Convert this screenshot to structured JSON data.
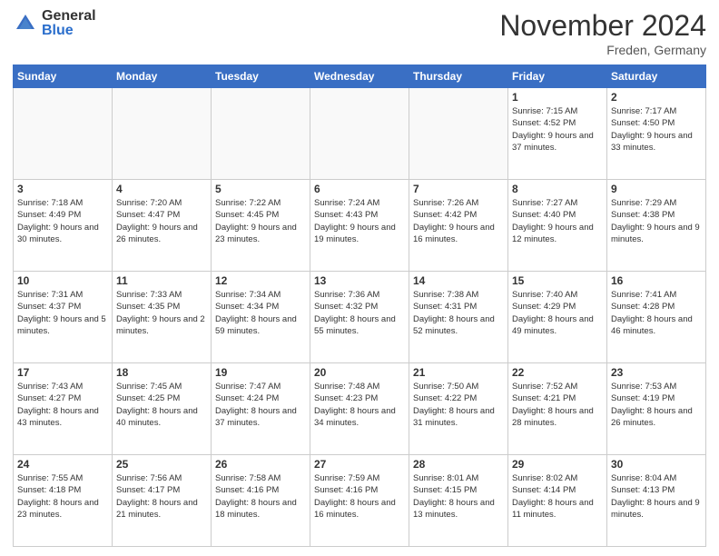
{
  "logo": {
    "general": "General",
    "blue": "Blue"
  },
  "header": {
    "month": "November 2024",
    "location": "Freden, Germany"
  },
  "days_of_week": [
    "Sunday",
    "Monday",
    "Tuesday",
    "Wednesday",
    "Thursday",
    "Friday",
    "Saturday"
  ],
  "weeks": [
    [
      {
        "day": "",
        "info": ""
      },
      {
        "day": "",
        "info": ""
      },
      {
        "day": "",
        "info": ""
      },
      {
        "day": "",
        "info": ""
      },
      {
        "day": "",
        "info": ""
      },
      {
        "day": "1",
        "info": "Sunrise: 7:15 AM\nSunset: 4:52 PM\nDaylight: 9 hours and 37 minutes."
      },
      {
        "day": "2",
        "info": "Sunrise: 7:17 AM\nSunset: 4:50 PM\nDaylight: 9 hours and 33 minutes."
      }
    ],
    [
      {
        "day": "3",
        "info": "Sunrise: 7:18 AM\nSunset: 4:49 PM\nDaylight: 9 hours and 30 minutes."
      },
      {
        "day": "4",
        "info": "Sunrise: 7:20 AM\nSunset: 4:47 PM\nDaylight: 9 hours and 26 minutes."
      },
      {
        "day": "5",
        "info": "Sunrise: 7:22 AM\nSunset: 4:45 PM\nDaylight: 9 hours and 23 minutes."
      },
      {
        "day": "6",
        "info": "Sunrise: 7:24 AM\nSunset: 4:43 PM\nDaylight: 9 hours and 19 minutes."
      },
      {
        "day": "7",
        "info": "Sunrise: 7:26 AM\nSunset: 4:42 PM\nDaylight: 9 hours and 16 minutes."
      },
      {
        "day": "8",
        "info": "Sunrise: 7:27 AM\nSunset: 4:40 PM\nDaylight: 9 hours and 12 minutes."
      },
      {
        "day": "9",
        "info": "Sunrise: 7:29 AM\nSunset: 4:38 PM\nDaylight: 9 hours and 9 minutes."
      }
    ],
    [
      {
        "day": "10",
        "info": "Sunrise: 7:31 AM\nSunset: 4:37 PM\nDaylight: 9 hours and 5 minutes."
      },
      {
        "day": "11",
        "info": "Sunrise: 7:33 AM\nSunset: 4:35 PM\nDaylight: 9 hours and 2 minutes."
      },
      {
        "day": "12",
        "info": "Sunrise: 7:34 AM\nSunset: 4:34 PM\nDaylight: 8 hours and 59 minutes."
      },
      {
        "day": "13",
        "info": "Sunrise: 7:36 AM\nSunset: 4:32 PM\nDaylight: 8 hours and 55 minutes."
      },
      {
        "day": "14",
        "info": "Sunrise: 7:38 AM\nSunset: 4:31 PM\nDaylight: 8 hours and 52 minutes."
      },
      {
        "day": "15",
        "info": "Sunrise: 7:40 AM\nSunset: 4:29 PM\nDaylight: 8 hours and 49 minutes."
      },
      {
        "day": "16",
        "info": "Sunrise: 7:41 AM\nSunset: 4:28 PM\nDaylight: 8 hours and 46 minutes."
      }
    ],
    [
      {
        "day": "17",
        "info": "Sunrise: 7:43 AM\nSunset: 4:27 PM\nDaylight: 8 hours and 43 minutes."
      },
      {
        "day": "18",
        "info": "Sunrise: 7:45 AM\nSunset: 4:25 PM\nDaylight: 8 hours and 40 minutes."
      },
      {
        "day": "19",
        "info": "Sunrise: 7:47 AM\nSunset: 4:24 PM\nDaylight: 8 hours and 37 minutes."
      },
      {
        "day": "20",
        "info": "Sunrise: 7:48 AM\nSunset: 4:23 PM\nDaylight: 8 hours and 34 minutes."
      },
      {
        "day": "21",
        "info": "Sunrise: 7:50 AM\nSunset: 4:22 PM\nDaylight: 8 hours and 31 minutes."
      },
      {
        "day": "22",
        "info": "Sunrise: 7:52 AM\nSunset: 4:21 PM\nDaylight: 8 hours and 28 minutes."
      },
      {
        "day": "23",
        "info": "Sunrise: 7:53 AM\nSunset: 4:19 PM\nDaylight: 8 hours and 26 minutes."
      }
    ],
    [
      {
        "day": "24",
        "info": "Sunrise: 7:55 AM\nSunset: 4:18 PM\nDaylight: 8 hours and 23 minutes."
      },
      {
        "day": "25",
        "info": "Sunrise: 7:56 AM\nSunset: 4:17 PM\nDaylight: 8 hours and 21 minutes."
      },
      {
        "day": "26",
        "info": "Sunrise: 7:58 AM\nSunset: 4:16 PM\nDaylight: 8 hours and 18 minutes."
      },
      {
        "day": "27",
        "info": "Sunrise: 7:59 AM\nSunset: 4:16 PM\nDaylight: 8 hours and 16 minutes."
      },
      {
        "day": "28",
        "info": "Sunrise: 8:01 AM\nSunset: 4:15 PM\nDaylight: 8 hours and 13 minutes."
      },
      {
        "day": "29",
        "info": "Sunrise: 8:02 AM\nSunset: 4:14 PM\nDaylight: 8 hours and 11 minutes."
      },
      {
        "day": "30",
        "info": "Sunrise: 8:04 AM\nSunset: 4:13 PM\nDaylight: 8 hours and 9 minutes."
      }
    ]
  ]
}
